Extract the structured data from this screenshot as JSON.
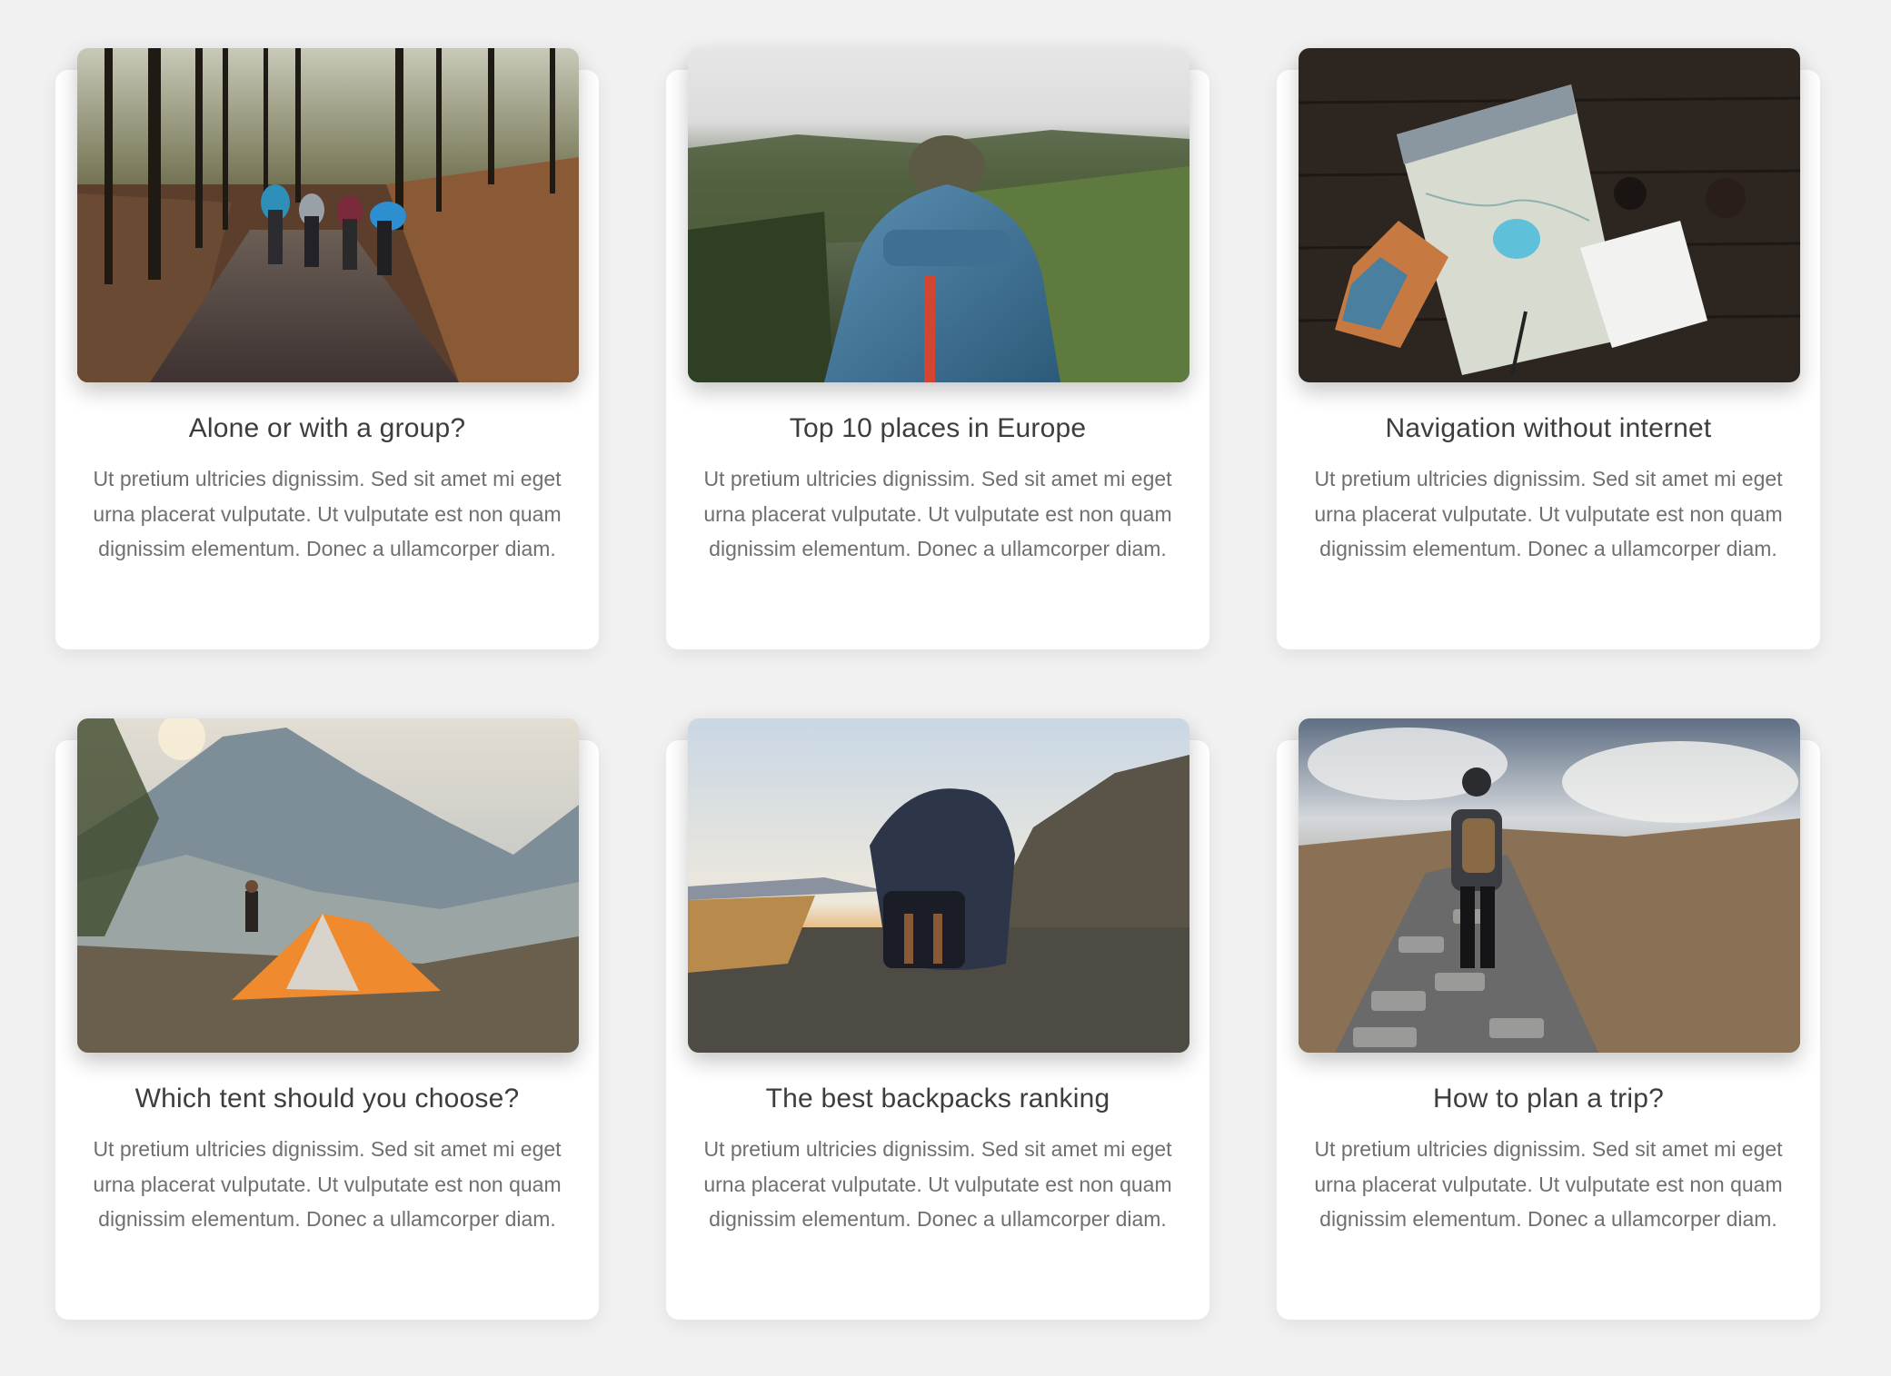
{
  "cards": [
    {
      "title": "Alone or with a group?",
      "text": "Ut pretium ultricies dignissim. Sed sit amet mi eget urna placerat vulputate. Ut vulputate est non quam dignissim elementum. Donec a ullamcorper diam.",
      "image": "group-hikers-forest-trail"
    },
    {
      "title": "Top 10 places in Europe",
      "text": "Ut pretium ultricies dignissim. Sed sit amet mi eget urna placerat vulputate. Ut vulputate est non quam dignissim elementum. Donec a ullamcorper diam.",
      "image": "hiker-blue-backpack-misty-valley"
    },
    {
      "title": "Navigation without internet",
      "text": "Ut pretium ultricies dignissim. Sed sit amet mi eget urna placerat vulputate. Ut vulputate est non quam dignissim elementum. Donec a ullamcorper diam.",
      "image": "paper-map-on-wooden-table"
    },
    {
      "title": "Which tent should you choose?",
      "text": "Ut pretium ultricies dignissim. Sed sit amet mi eget urna placerat vulputate. Ut vulputate est non quam dignissim elementum. Donec a ullamcorper diam.",
      "image": "orange-tent-mountain-camp"
    },
    {
      "title": "The best backpacks ranking",
      "text": "Ut pretium ultricies dignissim. Sed sit amet mi eget urna placerat vulputate. Ut vulputate est non quam dignissim elementum. Donec a ullamcorper diam.",
      "image": "backpack-on-rocky-ground-sunset"
    },
    {
      "title": "How to plan a trip?",
      "text": "Ut pretium ultricies dignissim. Sed sit amet mi eget urna placerat vulputate. Ut vulputate est non quam dignissim elementum. Donec a ullamcorper diam.",
      "image": "hiker-on-stone-path-hills"
    }
  ]
}
